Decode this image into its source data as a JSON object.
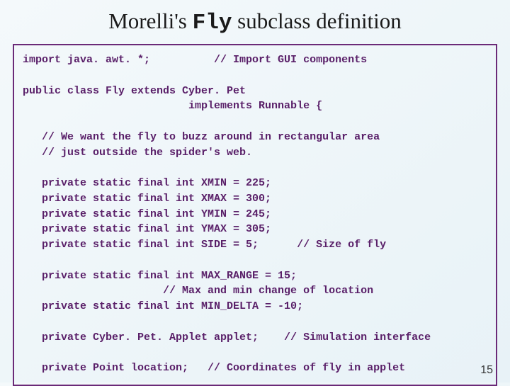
{
  "title": {
    "prefix": "Morelli's ",
    "mono": "Fly",
    "suffix": " subclass definition"
  },
  "code": {
    "l01": "import java. awt. *;          // Import GUI components",
    "l02": "",
    "l03": "public class Fly extends Cyber. Pet",
    "l04": "                          implements Runnable {",
    "l05": "",
    "l06": "   // We want the fly to buzz around in rectangular area",
    "l07": "   // just outside the spider's web.",
    "l08": "",
    "l09": "   private static final int XMIN = 225;",
    "l10": "   private static final int XMAX = 300;",
    "l11": "   private static final int YMIN = 245;",
    "l12": "   private static final int YMAX = 305;",
    "l13": "   private static final int SIDE = 5;      // Size of fly",
    "l14": "",
    "l15": "   private static final int MAX_RANGE = 15;",
    "l16": "                      // Max and min change of location",
    "l17": "   private static final int MIN_DELTA = -10;",
    "l18": "",
    "l19": "   private Cyber. Pet. Applet applet;    // Simulation interface",
    "l20": "",
    "l21": "   private Point location;   // Coordinates of fly in applet"
  },
  "pagenum": "15"
}
